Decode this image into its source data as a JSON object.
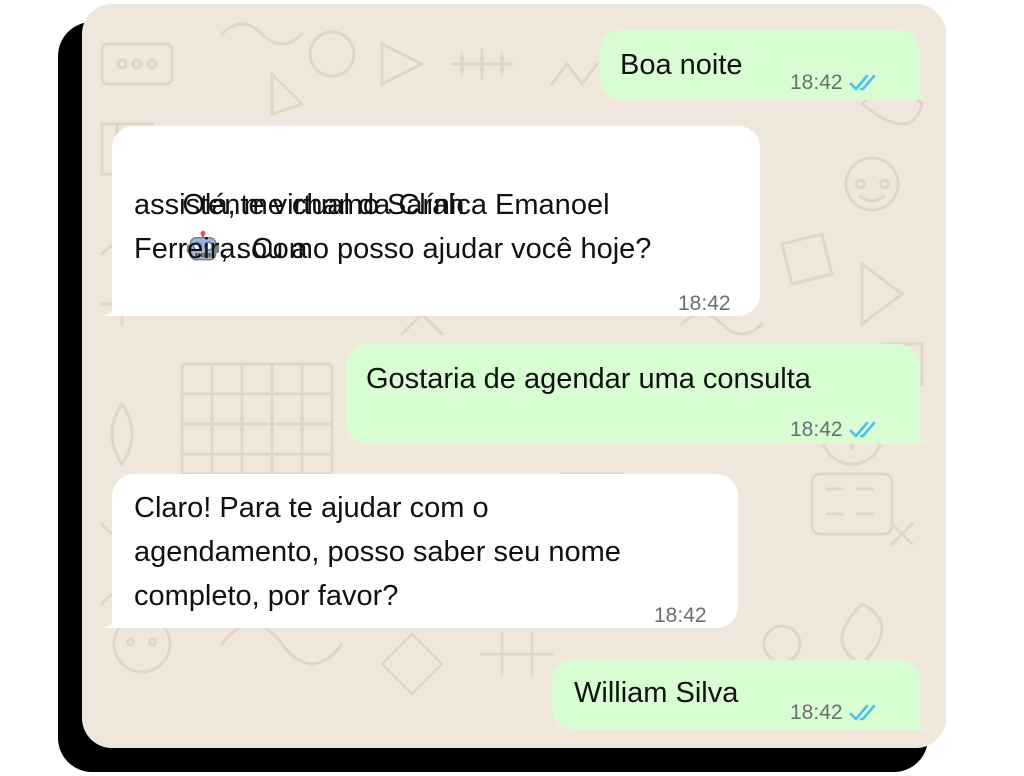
{
  "conversation": {
    "messages": [
      {
        "direction": "outgoing",
        "text": "Boa noite",
        "time": "18:42",
        "status_icon": "double-check-read-icon"
      },
      {
        "direction": "incoming",
        "lines": [
          "Olá, me chamo Sarah",
          ", sou a",
          "assistente virtual da Clínica Emanoel",
          "Ferreira. Como posso ajudar você hoje?"
        ],
        "emoji": "robot-face-icon",
        "time": "18:42"
      },
      {
        "direction": "outgoing",
        "text": "Gostaria de agendar uma consulta",
        "time": "18:42",
        "status_icon": "double-check-read-icon"
      },
      {
        "direction": "incoming",
        "lines": [
          "Claro! Para te ajudar com o",
          "agendamento, posso saber seu nome",
          "completo, por favor?"
        ],
        "time": "18:42"
      },
      {
        "direction": "outgoing",
        "text": "William Silva",
        "time": "18:42",
        "status_icon": "double-check-read-icon"
      }
    ]
  },
  "colors": {
    "chat_background": "#efe7dc",
    "outgoing_bubble": "#d9fdd3",
    "incoming_bubble": "#ffffff",
    "read_ticks": "#53bdeb",
    "timestamp": "#6b6f72"
  }
}
